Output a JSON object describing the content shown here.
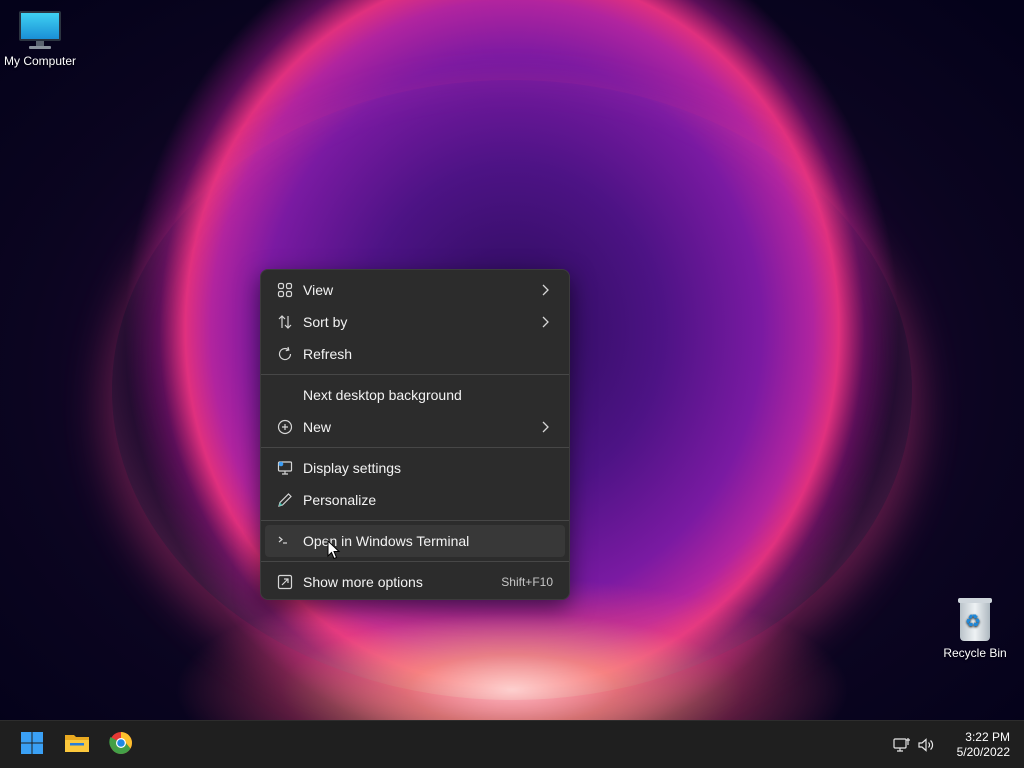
{
  "desktop": {
    "icons": [
      {
        "label": "My Computer",
        "icon": "monitor-icon"
      },
      {
        "label": "Recycle Bin",
        "icon": "recycle-bin-icon"
      }
    ]
  },
  "context_menu": {
    "items": [
      {
        "label": "View",
        "icon": "grid-icon",
        "submenu": true
      },
      {
        "label": "Sort by",
        "icon": "sort-arrows-icon",
        "submenu": true
      },
      {
        "label": "Refresh",
        "icon": "refresh-icon",
        "submenu": false
      },
      {
        "label": "Next desktop background",
        "icon": "",
        "submenu": false
      },
      {
        "label": "New",
        "icon": "plus-circle-icon",
        "submenu": true
      },
      {
        "label": "Display settings",
        "icon": "display-icon",
        "submenu": false
      },
      {
        "label": "Personalize",
        "icon": "pen-icon",
        "submenu": false
      },
      {
        "label": "Open in Windows Terminal",
        "icon": "terminal-icon",
        "submenu": false,
        "hovered": true
      },
      {
        "label": "Show more options",
        "icon": "expand-icon",
        "shortcut": "Shift+F10"
      }
    ]
  },
  "taskbar": {
    "pinned": [
      {
        "name": "Start",
        "icon": "windows-start-icon"
      },
      {
        "name": "File Explorer",
        "icon": "folder-icon"
      },
      {
        "name": "Google Chrome",
        "icon": "chrome-icon"
      }
    ],
    "tray": {
      "icons": [
        "network-icon",
        "volume-icon"
      ],
      "time": "3:22 PM",
      "date": "5/20/2022"
    }
  },
  "colors": {
    "menu_bg": "#2c2c2c",
    "menu_hover": "#383838",
    "taskbar_bg": "#1f1f1f",
    "accent_blue": "#3a9bf3"
  }
}
